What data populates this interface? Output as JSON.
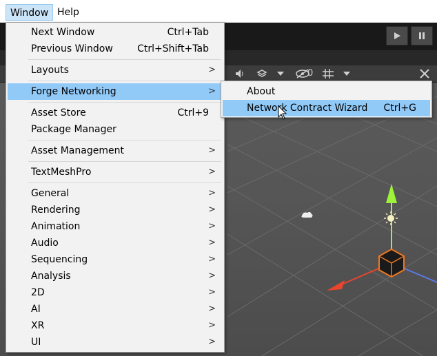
{
  "menubar": {
    "items": [
      {
        "label": "Window"
      },
      {
        "label": "Help"
      }
    ]
  },
  "window_menu": {
    "items": [
      {
        "label": "Next Window",
        "shortcut": "Ctrl+Tab"
      },
      {
        "label": "Previous Window",
        "shortcut": "Ctrl+Shift+Tab"
      },
      {
        "label": "Layouts",
        "submenu": true
      },
      {
        "label": "Forge Networking",
        "submenu": true,
        "highlighted": true
      },
      {
        "label": "Asset Store",
        "shortcut": "Ctrl+9"
      },
      {
        "label": "Package Manager"
      },
      {
        "label": "Asset Management",
        "submenu": true
      },
      {
        "label": "TextMeshPro",
        "submenu": true
      },
      {
        "label": "General",
        "submenu": true
      },
      {
        "label": "Rendering",
        "submenu": true
      },
      {
        "label": "Animation",
        "submenu": true
      },
      {
        "label": "Audio",
        "submenu": true
      },
      {
        "label": "Sequencing",
        "submenu": true
      },
      {
        "label": "Analysis",
        "submenu": true
      },
      {
        "label": "2D",
        "submenu": true
      },
      {
        "label": "AI",
        "submenu": true
      },
      {
        "label": "XR",
        "submenu": true
      },
      {
        "label": "UI",
        "submenu": true
      }
    ],
    "submenu_arrow": ">"
  },
  "forge_submenu": {
    "items": [
      {
        "label": "About"
      },
      {
        "label": "Network Contract Wizard",
        "shortcut": "Ctrl+G",
        "highlighted": true
      }
    ]
  },
  "scene_toolbar": {
    "hidden_count": "0"
  },
  "colors": {
    "highlight": "#91c9f7",
    "menu_bg": "#f2f2f2",
    "active_topmenu": "#cce4f7",
    "gizmo_y": "#9ef23a",
    "gizmo_x": "#e8452c",
    "gizmo_z": "#5a7ae8"
  }
}
